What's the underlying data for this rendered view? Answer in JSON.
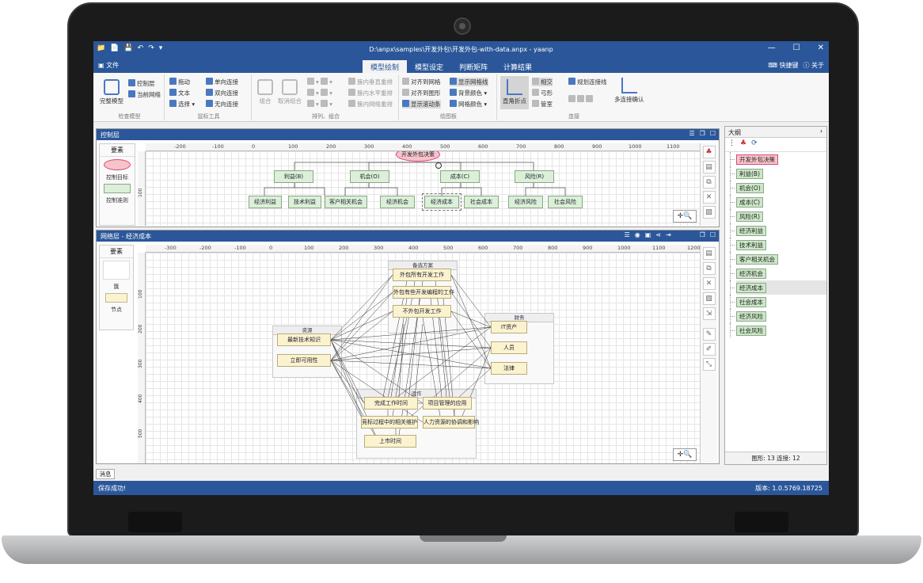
{
  "window": {
    "title": "D:\\anpx\\samples\\开发外包\\开发外包-with-data.anpx - yaanp"
  },
  "menu": {
    "file": "文件",
    "tabs": [
      "模型绘制",
      "模型设定",
      "判断矩阵",
      "计算结果"
    ],
    "shortcuts": "快捷键",
    "about": "关于"
  },
  "ribbon": {
    "check_model": {
      "complete_model": "完整模型",
      "control_layer": "控制层",
      "current_network": "当前网络",
      "label": "检查模型"
    },
    "mouse_tools": {
      "drag": "拖动",
      "text": "文本",
      "select": "选择",
      "one_way": "单向连接",
      "two_way": "双向连接",
      "no_dir": "无向连接",
      "label": "鼠标工具"
    },
    "arrange": {
      "combine": "组合",
      "uncombine": "取消组合",
      "grp_vcenter": "簇内垂直重排",
      "grp_hcenter": "簇内水平重排",
      "grp_network": "簇内网络重排",
      "label": "排列、组合"
    },
    "canvas": {
      "align_grid": "对齐到网格",
      "align_shape": "对齐到图形",
      "show_scroll": "显示滚动条",
      "show_grid": "显示网格线",
      "bg_color": "背景颜色",
      "grid_color": "网格颜色",
      "label": "绘图板"
    },
    "connect": {
      "right_angle": "直角折点",
      "intersect": "相交",
      "arc": "弓形",
      "tube": "管室",
      "plan_line": "规划连接线",
      "multi": "多连接确认",
      "label": "连接"
    }
  },
  "control_pane": {
    "title": "控制层",
    "palette_title": "要素",
    "palette_items": [
      "控制目标",
      "控制准则"
    ],
    "root": "开发外包决策",
    "level2": [
      "利益(B)",
      "机会(O)",
      "成本(C)",
      "风险(R)"
    ],
    "level3": [
      "经济利益",
      "技术利益",
      "客户相关机会",
      "经济机会",
      "经济成本",
      "社会成本",
      "经济风险",
      "社会风险"
    ]
  },
  "network_pane": {
    "title": "网络层 - 经济成本",
    "palette_title": "要素",
    "palette_items": [
      "簇",
      "节点"
    ],
    "clusters": {
      "alternatives": {
        "title": "备选方案",
        "nodes": [
          "外包所有开发工作",
          "外包有些开发编程的工作",
          "不外包开发工作"
        ]
      },
      "finance": {
        "title": "财务",
        "nodes": [
          "IT资产",
          "人员",
          "法律"
        ]
      },
      "resources": {
        "title": "资源",
        "nodes": [
          "最新技术知识",
          "立即可用性"
        ]
      },
      "operations": {
        "title": "运作",
        "nodes": [
          "完成工作时间",
          "项目管理的应用",
          "竞标过程中的相关维护",
          "人力资源的协调和影响",
          "上市时间"
        ]
      }
    }
  },
  "ruler_h": [
    "-200",
    "-100",
    "0",
    "100",
    "200",
    "300",
    "400",
    "500",
    "600",
    "700",
    "800",
    "900",
    "1000",
    "1100"
  ],
  "ruler_h2": [
    "-300",
    "-200",
    "-100",
    "0",
    "100",
    "200",
    "300",
    "400",
    "500",
    "600",
    "700",
    "800",
    "900",
    "1000",
    "1100",
    "1200"
  ],
  "ruler_v": [
    "100"
  ],
  "ruler_v2": [
    "100",
    "200",
    "300",
    "400",
    "500"
  ],
  "outline": {
    "title": "大纲",
    "items": [
      "开发外包决策",
      "利益(B)",
      "机会(O)",
      "成本(C)",
      "风险(R)",
      "经济利益",
      "技术利益",
      "客户相关机会",
      "经济机会",
      "经济成本",
      "社会成本",
      "经济风险",
      "社会风险"
    ],
    "footer": "图形: 13  连接: 12"
  },
  "messages_tab": "消息",
  "status": {
    "message": "保存成功!",
    "version": "版本: 1.0.5769.18725"
  },
  "colors": {
    "accent": "#2b579a",
    "criteria_fill": "#dcefd8",
    "goal_fill": "#f6c4c8",
    "node_fill": "#fbf3cf"
  }
}
